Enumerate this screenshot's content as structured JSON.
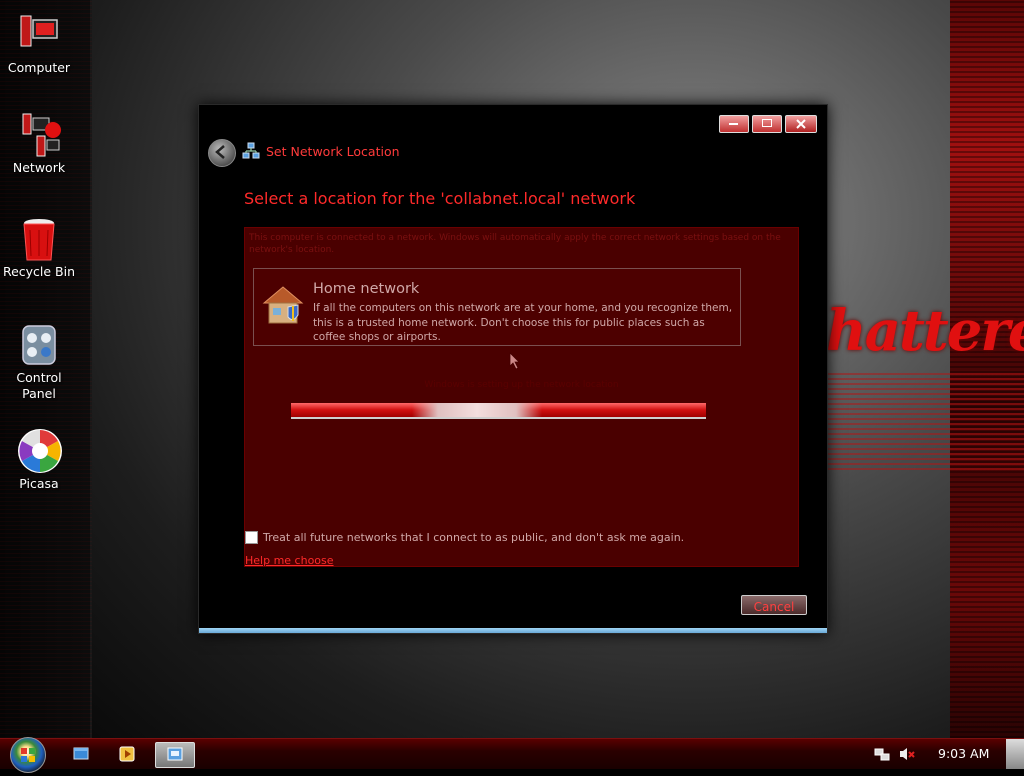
{
  "desktop": {
    "graffiti_text": "hatterer",
    "icons": [
      {
        "label": "Computer",
        "icon": "computer-icon"
      },
      {
        "label": "Network",
        "icon": "network-icon"
      },
      {
        "label": "Recycle Bin",
        "icon": "recycle-bin-icon"
      },
      {
        "label": "Control Panel",
        "icon": "control-panel-icon"
      },
      {
        "label": "Picasa",
        "icon": "picasa-icon"
      }
    ]
  },
  "window": {
    "title": "Set Network Location",
    "heading": "Select a location for the 'collabnet.local' network",
    "description": "This computer is connected to a network. Windows will automatically apply the correct network settings based on the network's location.",
    "option": {
      "title": "Home network",
      "description": "If all the computers on this network are at your home, and you recognize them, this is a trusted home network.  Don't choose this for public places such as coffee shops or airports."
    },
    "status_text": "Windows is setting up the network location",
    "progress_marquee": 0.4,
    "checkbox_label": "Treat all future networks that I connect to as public, and don't ask me again.",
    "help_link": "Help me choose",
    "cancel_label": "Cancel"
  },
  "taskbar": {
    "clock": "9:03 AM"
  },
  "colors": {
    "accent_red": "#ff2a2a",
    "panel_bg": "#4a0000",
    "text_pink": "#d0a8a8"
  }
}
